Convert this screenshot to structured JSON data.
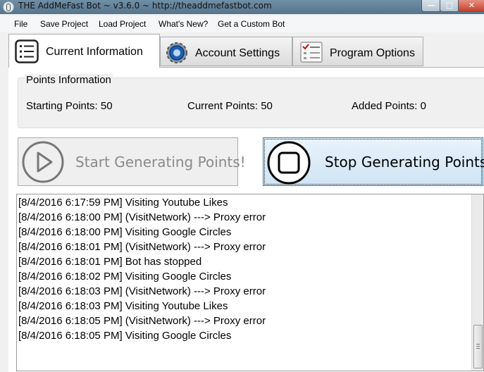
{
  "window": {
    "title": "THE AddMeFast Bot ~ v3.6.0 ~ http://theaddmefastbot.com",
    "minimize_glyph": "—",
    "maximize_glyph": "□",
    "close_glyph": "✕"
  },
  "menu": [
    "File",
    "Save Project",
    "Load Project",
    "What's New?",
    "Get a Custom Bot"
  ],
  "tabs": [
    {
      "label": "Current Information",
      "icon": "list-icon",
      "active": true
    },
    {
      "label": "Account Settings",
      "icon": "gear-icon",
      "active": false
    },
    {
      "label": "Program Options",
      "icon": "checklist-icon",
      "active": false
    }
  ],
  "points": {
    "group_title": "Points Information",
    "starting": "Starting Points: 50",
    "current": "Current Points: 50",
    "added": "Added Points: 0"
  },
  "buttons": {
    "start_label": "Start Generating Points!",
    "stop_label": "Stop Generating Points"
  },
  "log": [
    "[8/4/2016 6:17:59 PM] Visiting Youtube Likes",
    "[8/4/2016 6:18:00 PM] (VisitNetwork) ---> Proxy error",
    "[8/4/2016 6:18:00 PM] Visiting Google Circles",
    "[8/4/2016 6:18:01 PM] (VisitNetwork) ---> Proxy error",
    "[8/4/2016 6:18:01 PM] Bot has stopped",
    "[8/4/2016 6:18:02 PM] Visiting Google Circles",
    "[8/4/2016 6:18:03 PM] (VisitNetwork) ---> Proxy error",
    "[8/4/2016 6:18:03 PM] Visiting Youtube Likes",
    "[8/4/2016 6:18:05 PM] (VisitNetwork) ---> Proxy error",
    "[8/4/2016 6:18:05 PM] Visiting Google Circles"
  ],
  "colors": {
    "titlebar": "#6f8fa6",
    "stop_button": "#cfe4f4",
    "start_button": "#efefef"
  }
}
